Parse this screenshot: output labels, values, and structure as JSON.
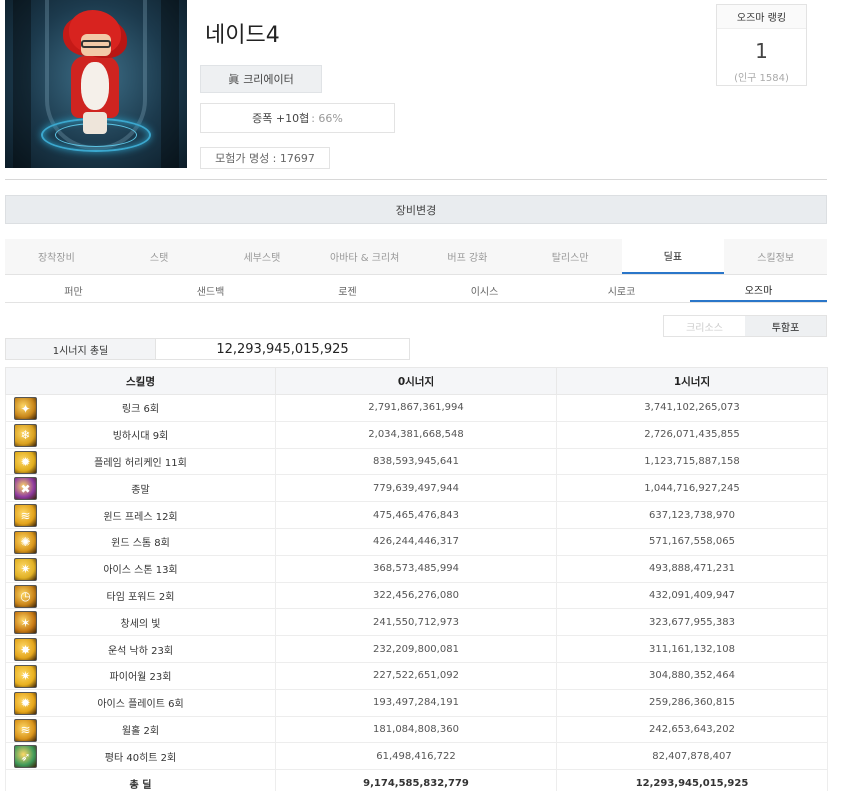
{
  "character": {
    "name": "네이드4",
    "guild_label": "크리에이터",
    "buff_label": "증폭 +10협",
    "buff_sub": ": 66%",
    "fame": "모험가 명성 : 17697"
  },
  "ranking": {
    "title": "오즈마 랭킹",
    "rank": "1",
    "population": "(인구 1584)"
  },
  "equip_bar": "장비변경",
  "tabs_main": [
    "장착장비",
    "스탯",
    "세부스탯",
    "아바타 & 크리쳐",
    "버프 강화",
    "탈리스만",
    "딜표",
    "스킬정보"
  ],
  "tabs_sub": [
    "퍼만",
    "샌드백",
    "로젠",
    "이시스",
    "시로코",
    "오즈마"
  ],
  "filter": [
    "크리소스",
    "투함포"
  ],
  "synergy_total": {
    "label": "1시너지 총딜",
    "value": "12,293,945,015,925"
  },
  "table": {
    "headers": [
      "스킬명",
      "0시너지",
      "1시너지"
    ],
    "rows": [
      {
        "name": "링크 6회",
        "s0": "2,791,867,361,994",
        "s1": "3,741,102,265,073",
        "icon_color": "#c8861a"
      },
      {
        "name": "빙하시대 9회",
        "s0": "2,034,381,668,548",
        "s1": "2,726,071,435,855",
        "icon_color": "#d9a01e"
      },
      {
        "name": "플레임 허리케인 11회",
        "s0": "838,593,945,641",
        "s1": "1,123,715,887,158",
        "icon_color": "#e0ac1c"
      },
      {
        "name": "종말",
        "s0": "779,639,497,944",
        "s1": "1,044,716,927,245",
        "icon_color": "#8e3aa0"
      },
      {
        "name": "윈드 프레스 12회",
        "s0": "475,465,476,843",
        "s1": "637,123,738,970",
        "icon_color": "#e2a21a"
      },
      {
        "name": "윈드 스톰 8회",
        "s0": "426,244,446,317",
        "s1": "571,167,558,065",
        "icon_color": "#d8951a"
      },
      {
        "name": "아이스 스톤 13회",
        "s0": "368,573,485,994",
        "s1": "493,888,471,231",
        "icon_color": "#e0b024"
      },
      {
        "name": "타임 포워드 2회",
        "s0": "322,456,276,080",
        "s1": "432,091,409,947",
        "icon_color": "#c98418"
      },
      {
        "name": "창세의 빛",
        "s0": "241,550,712,973",
        "s1": "323,677,955,383",
        "icon_color": "#c87a14"
      },
      {
        "name": "운석 낙하 23회",
        "s0": "232,209,800,081",
        "s1": "311,161,132,108",
        "icon_color": "#e3a51c"
      },
      {
        "name": "파이어월 23회",
        "s0": "227,522,651,092",
        "s1": "304,880,352,464",
        "icon_color": "#e8b01e"
      },
      {
        "name": "아이스 플레이트 6회",
        "s0": "193,497,284,191",
        "s1": "259,286,360,815",
        "icon_color": "#e5a418"
      },
      {
        "name": "윌홀 2회",
        "s0": "181,084,808,360",
        "s1": "242,653,643,202",
        "icon_color": "#d8931a"
      },
      {
        "name": "평타 40히트 2회",
        "s0": "61,498,416,722",
        "s1": "82,407,878,407",
        "icon_color": "#3f9a5a"
      }
    ],
    "total": {
      "name": "총 딜",
      "s0": "9,174,585,832,779",
      "s1": "12,293,945,015,925"
    }
  }
}
